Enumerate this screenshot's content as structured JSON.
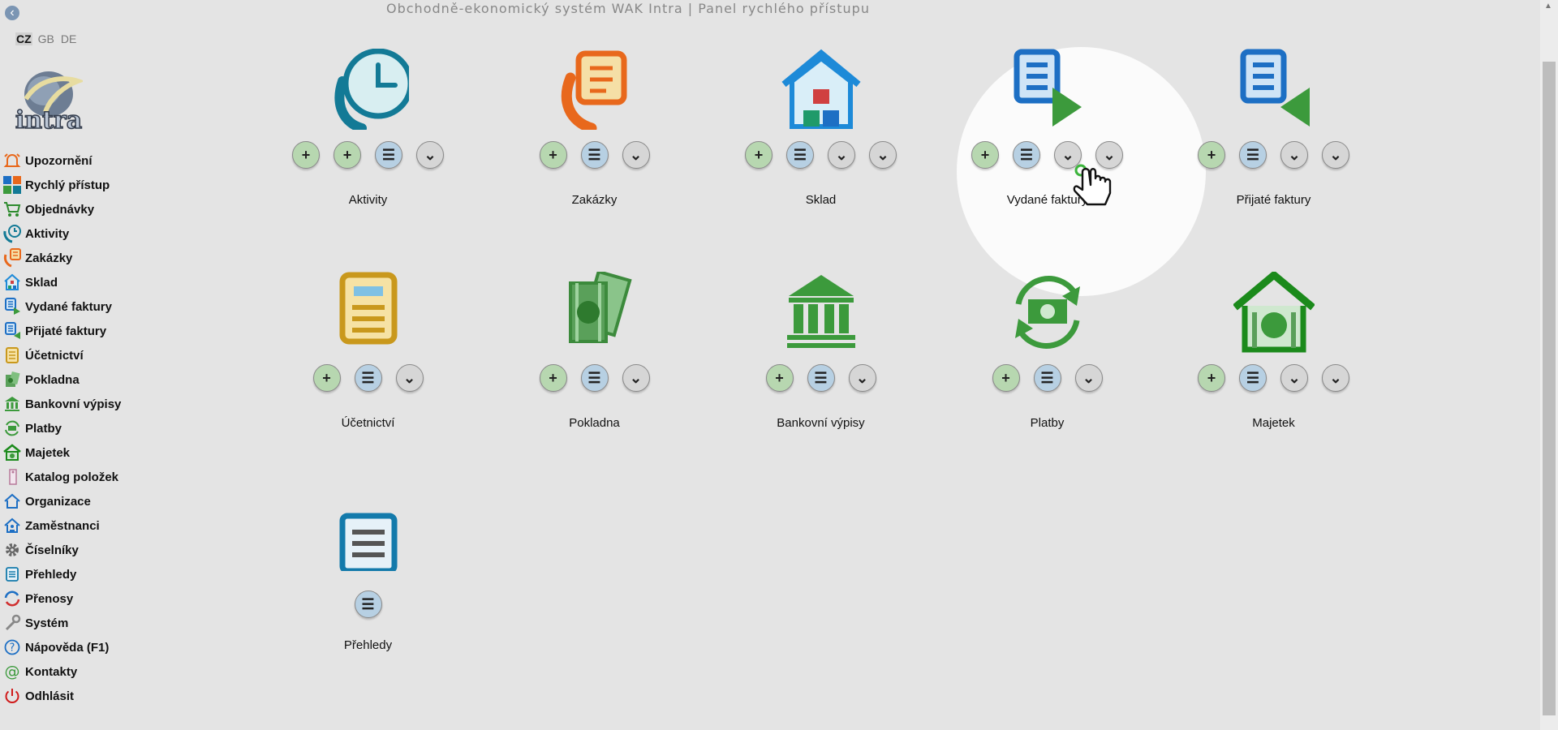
{
  "header": {
    "title": "Obchodně-ekonomický systém WAK Intra  |  Panel rychlého přístupu"
  },
  "languages": [
    {
      "code": "CZ",
      "active": true
    },
    {
      "code": "GB",
      "active": false
    },
    {
      "code": "DE",
      "active": false
    }
  ],
  "logo": {
    "text": "intra"
  },
  "sidebar": {
    "items": [
      {
        "label": "Upozornění",
        "icon": "bell-icon"
      },
      {
        "label": "Rychlý přístup",
        "icon": "grid-icon"
      },
      {
        "label": "Objednávky",
        "icon": "cart-icon"
      },
      {
        "label": "Aktivity",
        "icon": "phone-clock-icon"
      },
      {
        "label": "Zakázky",
        "icon": "phone-note-icon"
      },
      {
        "label": "Sklad",
        "icon": "warehouse-icon"
      },
      {
        "label": "Vydané faktury",
        "icon": "invoice-out-icon"
      },
      {
        "label": "Přijaté faktury",
        "icon": "invoice-in-icon"
      },
      {
        "label": "Účetnictví",
        "icon": "ledger-icon"
      },
      {
        "label": "Pokladna",
        "icon": "cash-icon"
      },
      {
        "label": "Bankovní výpisy",
        "icon": "bank-icon"
      },
      {
        "label": "Platby",
        "icon": "payment-icon"
      },
      {
        "label": "Majetek",
        "icon": "property-icon"
      },
      {
        "label": "Katalog položek",
        "icon": "tag-icon"
      },
      {
        "label": "Organizace",
        "icon": "house-icon"
      },
      {
        "label": "Zaměstnanci",
        "icon": "person-house-icon"
      },
      {
        "label": "Číselníky",
        "icon": "gear-icon"
      },
      {
        "label": "Přehledy",
        "icon": "list-doc-icon"
      },
      {
        "label": "Přenosy",
        "icon": "sync-icon"
      },
      {
        "label": "Systém",
        "icon": "wrench-icon"
      },
      {
        "label": "Nápověda (F1)",
        "icon": "help-icon"
      },
      {
        "label": "Kontakty",
        "icon": "at-icon"
      },
      {
        "label": "Odhlásit",
        "icon": "power-icon"
      }
    ]
  },
  "tiles": [
    {
      "label": "Aktivity",
      "icon": "phone-clock-icon"
    },
    {
      "label": "Zakázky",
      "icon": "phone-note-icon"
    },
    {
      "label": "Sklad",
      "icon": "warehouse-icon"
    },
    {
      "label": "Vydané faktury",
      "icon": "invoice-out-icon"
    },
    {
      "label": "Přijaté faktury",
      "icon": "invoice-in-icon"
    },
    {
      "label": "Účetnictví",
      "icon": "ledger-icon"
    },
    {
      "label": "Pokladna",
      "icon": "cash-icon"
    },
    {
      "label": "Bankovní výpisy",
      "icon": "bank-icon"
    },
    {
      "label": "Platby",
      "icon": "payment-icon"
    },
    {
      "label": "Majetek",
      "icon": "property-icon"
    },
    {
      "label": "Přehledy",
      "icon": "list-doc-icon"
    }
  ],
  "buttons": {
    "add": "+",
    "list": "☰",
    "more": "⌄"
  },
  "colors": {
    "add": "#b7d7b0",
    "list": "#b7d0e3",
    "more": "#d6d6d6",
    "teal": "#137a96",
    "orange": "#e8681c",
    "blue": "#1d6fc4",
    "green": "#3c9a3c",
    "gold": "#c9981c"
  }
}
